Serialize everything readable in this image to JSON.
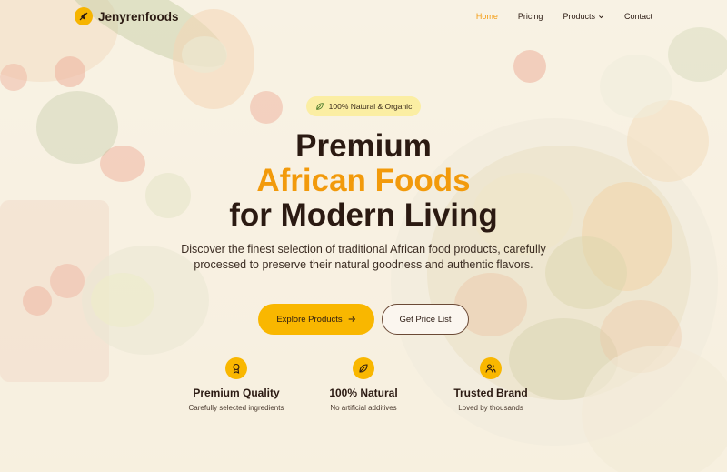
{
  "brand": {
    "name": "Jenyrenfoods",
    "logo_icon": "wheat-icon",
    "accent": "#f9b700",
    "accent_text": "#f29a0b",
    "dark_text": "#2b1a12"
  },
  "nav": {
    "items": [
      {
        "label": "Home",
        "active": true
      },
      {
        "label": "Pricing"
      },
      {
        "label": "Products",
        "has_dropdown": true
      },
      {
        "label": "Contact"
      }
    ]
  },
  "hero": {
    "badge": "100% Natural & Organic",
    "badge_icon": "leaf-icon",
    "title_line1": "Premium",
    "title_line2": "African Foods",
    "title_line3": "for Modern Living",
    "subtitle": "Discover the finest selection of traditional African food products, carefully processed to preserve their natural goodness and authentic flavors.",
    "primary_button": "Explore Products",
    "secondary_button": "Get Price List"
  },
  "features": [
    {
      "icon": "award-icon",
      "title": "Premium Quality",
      "desc": "Carefully selected ingredients"
    },
    {
      "icon": "leaf-icon",
      "title": "100% Natural",
      "desc": "No artificial additives"
    },
    {
      "icon": "users-icon",
      "title": "Trusted Brand",
      "desc": "Loved by thousands"
    }
  ]
}
